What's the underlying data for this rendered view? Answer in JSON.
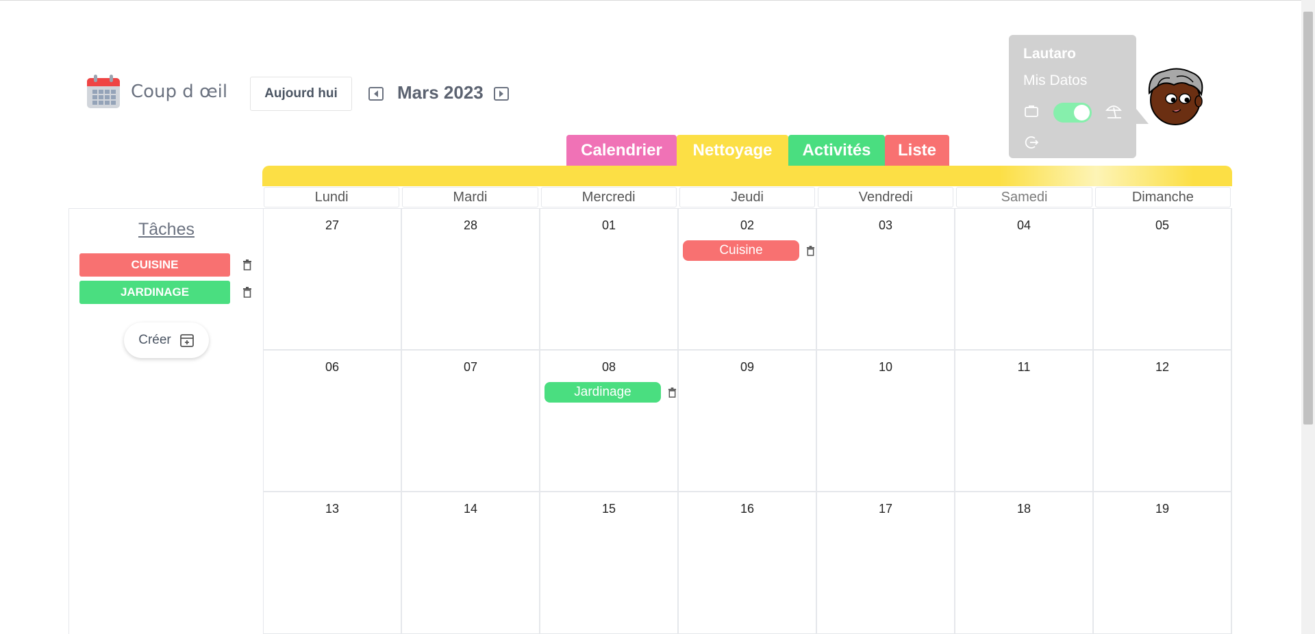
{
  "header": {
    "app_title": "Coup d œil",
    "today_button": "Aujourd hui",
    "month": "Mars 2023"
  },
  "tabs": [
    {
      "label": "Calendrier",
      "color": "#f072b6"
    },
    {
      "label": "Nettoyage",
      "color": "#fcdf45"
    },
    {
      "label": "Activités",
      "color": "#4ade80"
    },
    {
      "label": "Liste",
      "color": "#f87171"
    }
  ],
  "weekdays": [
    "Lundi",
    "Mardi",
    "Mercredi",
    "Jeudi",
    "Vendredi",
    "Samedi",
    "Dimanche"
  ],
  "sidebar": {
    "title": "Tâches",
    "tasks": [
      {
        "label": "CUISINE",
        "color": "#f87171"
      },
      {
        "label": "JARDINAGE",
        "color": "#4ade80"
      }
    ],
    "create_label": "Créer"
  },
  "weeks": [
    [
      "27",
      "28",
      "01",
      "02",
      "03",
      "04",
      "05"
    ],
    [
      "06",
      "07",
      "08",
      "09",
      "10",
      "11",
      "12"
    ],
    [
      "13",
      "14",
      "15",
      "16",
      "17",
      "18",
      "19"
    ]
  ],
  "events": [
    {
      "label": "Cuisine",
      "day": "02",
      "color": "#f87171"
    },
    {
      "label": "Jardinage",
      "day": "08",
      "color": "#4ade80"
    }
  ],
  "user": {
    "name": "Lautaro",
    "data_link": "Mis Datos",
    "toggle_on": true,
    "icons": [
      "briefcase-icon",
      "umbrella-beach-icon",
      "logout-icon"
    ]
  }
}
